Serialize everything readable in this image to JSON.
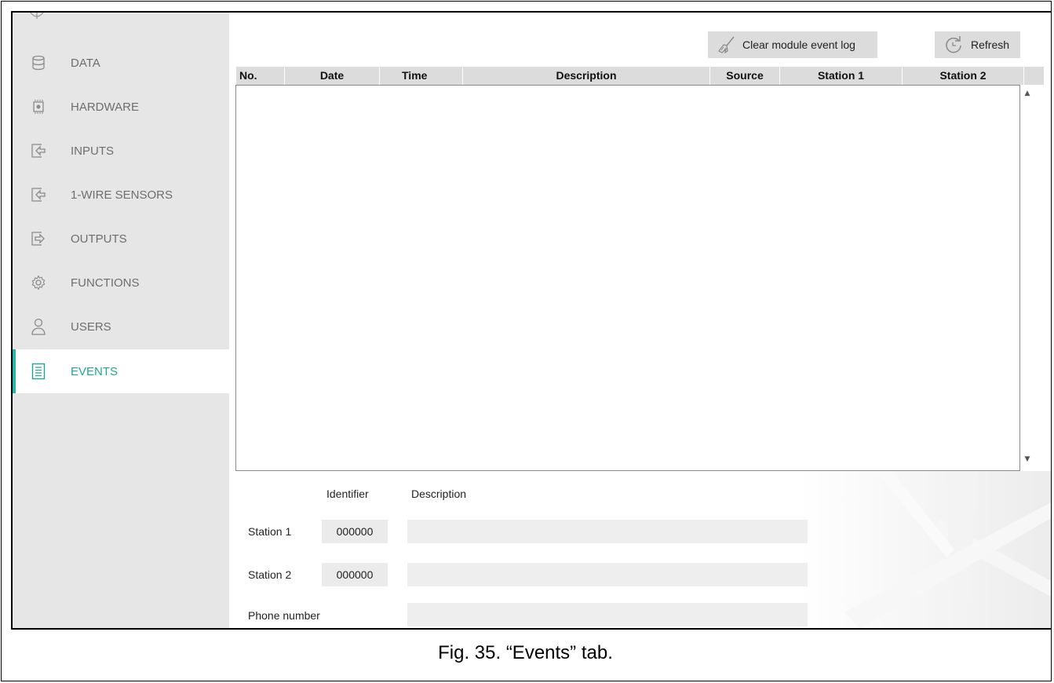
{
  "sidebar": {
    "items": [
      {
        "label": "DATA",
        "icon": "database-icon"
      },
      {
        "label": "HARDWARE",
        "icon": "chip-icon"
      },
      {
        "label": "INPUTS",
        "icon": "input-arrow-icon"
      },
      {
        "label": "1-WIRE SENSORS",
        "icon": "input-arrow-icon"
      },
      {
        "label": "OUTPUTS",
        "icon": "output-arrow-icon"
      },
      {
        "label": "FUNCTIONS",
        "icon": "gear-icon"
      },
      {
        "label": "USERS",
        "icon": "user-icon"
      },
      {
        "label": "EVENTS",
        "icon": "list-document-icon",
        "active": true
      }
    ]
  },
  "toolbar": {
    "clear_label": "Clear module event log",
    "refresh_label": "Refresh"
  },
  "table": {
    "columns": [
      "No.",
      "Date",
      "Time",
      "Description",
      "Source",
      "Station 1",
      "Station 2"
    ],
    "rows": []
  },
  "details": {
    "identifier_header": "Identifier",
    "description_header": "Description",
    "station1_label": "Station 1",
    "station1_identifier": "000000",
    "station1_description": "",
    "station2_label": "Station 2",
    "station2_identifier": "000000",
    "station2_description": "",
    "phone_label": "Phone number",
    "phone_value": ""
  },
  "caption": "Fig. 35. “Events” tab.",
  "colors": {
    "accent": "#2bb5a5",
    "active_text": "#22a395",
    "sidebar_bg": "#e6e6e6",
    "header_bg": "#dcdcdc"
  }
}
